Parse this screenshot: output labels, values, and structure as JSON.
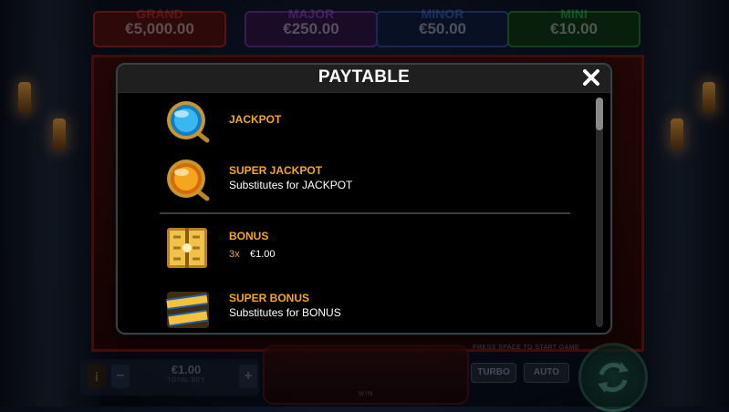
{
  "background": {
    "jackpots": [
      {
        "name": "GRAND",
        "value": "€5,000.00"
      },
      {
        "name": "MAJOR",
        "value": "€250.00"
      },
      {
        "name": "MINOR",
        "value": "€50.00"
      },
      {
        "name": "MINI",
        "value": "€10.00"
      }
    ],
    "bet": {
      "value": "€1.00",
      "label": "TOTAL BET",
      "info": "i",
      "minus": "−",
      "plus": "+"
    },
    "win_label": "WIN",
    "hint": "PRESS SPACE TO START GAME",
    "turbo_label": "TURBO",
    "auto_label": "AUTO"
  },
  "paytable": {
    "title": "PAYTABLE",
    "close_icon": "close-icon",
    "items": [
      {
        "name": "JACKPOT",
        "icon": "blue-jackpot-orb-icon"
      },
      {
        "name": "SUPER JACKPOT",
        "description": "Substitutes for JACKPOT",
        "icon": "gold-jackpot-orb-icon"
      },
      {
        "name": "BONUS",
        "multiplier": "3x",
        "amount": "€1.00",
        "icon": "gold-gate-bonus-icon"
      },
      {
        "name": "SUPER BONUS",
        "description": "Substitutes for BONUS",
        "icon": "super-bonus-logo-icon"
      }
    ]
  },
  "colors": {
    "accent": "#f5a623",
    "modal_bg": "#000000",
    "header_bg": "#1f1f1f"
  }
}
